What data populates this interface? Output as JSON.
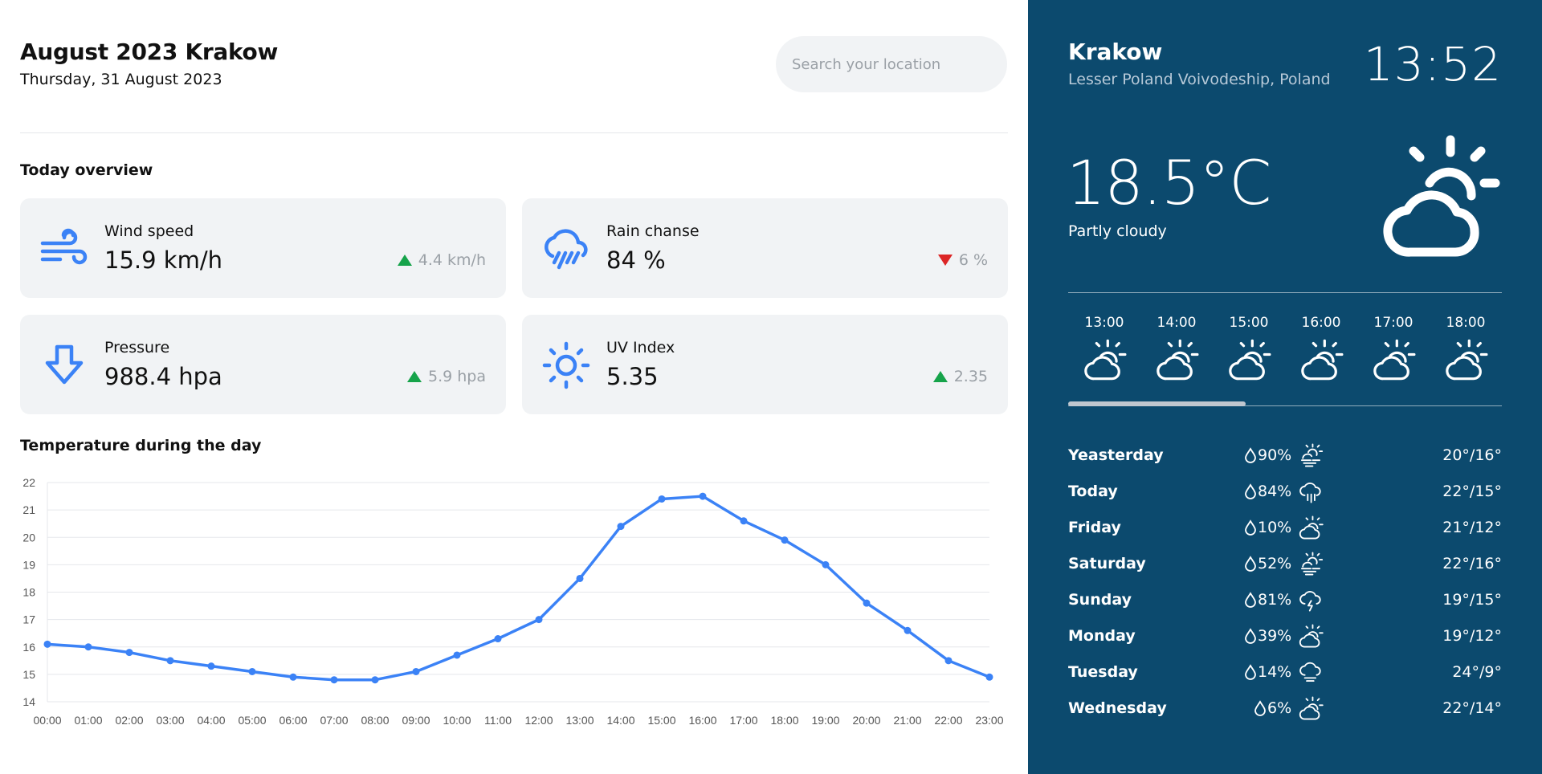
{
  "header": {
    "title": "August 2023 Krakow",
    "date": "Thursday, 31 August 2023",
    "search_placeholder": "Search your location"
  },
  "overview": {
    "title": "Today overview",
    "cards": [
      {
        "label": "Wind speed",
        "value": "15.9 km/h",
        "delta": "4.4 km/h",
        "trend": "up",
        "icon": "wind-icon"
      },
      {
        "label": "Rain chanse",
        "value": "84 %",
        "delta": "6 %",
        "trend": "down",
        "icon": "rain-icon"
      },
      {
        "label": "Pressure",
        "value": "988.4 hpa",
        "delta": "5.9 hpa",
        "trend": "up",
        "icon": "arrow-down-icon"
      },
      {
        "label": "UV Index",
        "value": "5.35",
        "delta": "2.35",
        "trend": "up",
        "icon": "sun-icon"
      }
    ]
  },
  "chart_section": {
    "title": "Temperature during the day"
  },
  "chart_data": {
    "type": "line",
    "title": "Temperature during the day",
    "xlabel": "",
    "ylabel": "",
    "ylim": [
      14,
      22
    ],
    "yticks": [
      14,
      15,
      16,
      17,
      18,
      19,
      20,
      21,
      22
    ],
    "categories": [
      "00:00",
      "01:00",
      "02:00",
      "03:00",
      "04:00",
      "05:00",
      "06:00",
      "07:00",
      "08:00",
      "09:00",
      "10:00",
      "11:00",
      "12:00",
      "13:00",
      "14:00",
      "15:00",
      "16:00",
      "17:00",
      "18:00",
      "19:00",
      "20:00",
      "21:00",
      "22:00",
      "23:00"
    ],
    "series": [
      {
        "values": [
          16.1,
          16.0,
          15.8,
          15.5,
          15.3,
          15.1,
          14.9,
          14.8,
          14.8,
          15.1,
          15.7,
          16.3,
          17.0,
          18.5,
          20.4,
          21.4,
          21.5,
          20.6,
          19.9,
          19.0,
          17.6,
          16.6,
          15.5,
          14.9
        ]
      }
    ],
    "grid": true,
    "color": "#3b82f6"
  },
  "sidebar": {
    "city": "Krakow",
    "region": "Lesser Poland Voivodeship, Poland",
    "time": "13:52",
    "temperature": "18.5°C",
    "condition": "Partly cloudy",
    "hourly": [
      {
        "time": "13:00",
        "icon": "partly-cloudy-icon"
      },
      {
        "time": "14:00",
        "icon": "partly-cloudy-icon"
      },
      {
        "time": "15:00",
        "icon": "partly-cloudy-icon"
      },
      {
        "time": "16:00",
        "icon": "partly-cloudy-icon"
      },
      {
        "time": "17:00",
        "icon": "partly-cloudy-icon"
      },
      {
        "time": "18:00",
        "icon": "partly-cloudy-icon"
      }
    ],
    "hourly_scroll_position": 0.41,
    "daily": [
      {
        "day": "Yeasterday",
        "rain": "90%",
        "icon": "fog-sun-icon",
        "range": "20°/16°"
      },
      {
        "day": "Today",
        "rain": "84%",
        "icon": "rain-icon",
        "range": "22°/15°"
      },
      {
        "day": "Friday",
        "rain": "10%",
        "icon": "partly-cloudy-icon",
        "range": "21°/12°"
      },
      {
        "day": "Saturday",
        "rain": "52%",
        "icon": "fog-sun-icon",
        "range": "22°/16°"
      },
      {
        "day": "Sunday",
        "rain": "81%",
        "icon": "thunder-icon",
        "range": "19°/15°"
      },
      {
        "day": "Monday",
        "rain": "39%",
        "icon": "partly-cloudy-icon",
        "range": "19°/12°"
      },
      {
        "day": "Tuesday",
        "rain": "14%",
        "icon": "cloud-wind-icon",
        "range": "24°/9°"
      },
      {
        "day": "Wednesday",
        "rain": "6%",
        "icon": "partly-cloudy-icon",
        "range": "22°/14°"
      }
    ]
  },
  "colors": {
    "sidebar_bg": "#0c4a6e",
    "accent": "#3b82f6",
    "trend_up": "#16a34a",
    "trend_down": "#dc2626",
    "card_bg": "#f1f3f5"
  }
}
